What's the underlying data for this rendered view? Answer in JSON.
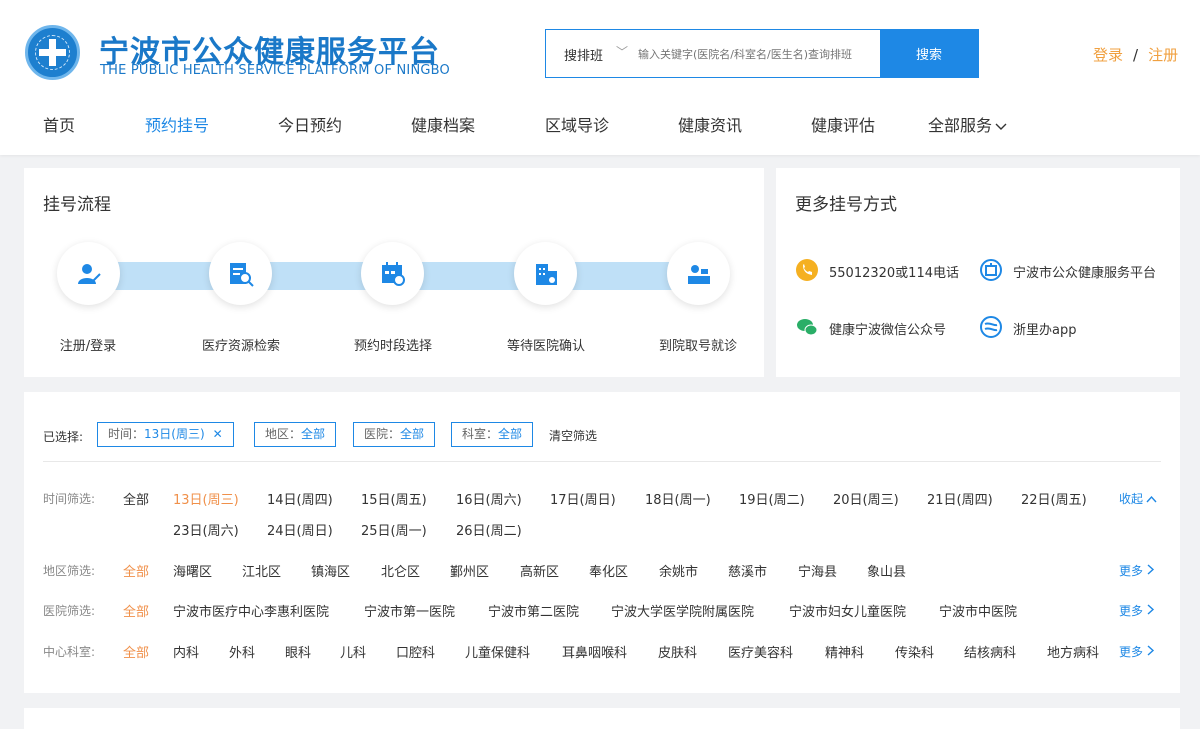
{
  "header": {
    "title": "宁波市公众健康服务平台",
    "subtitle": "THE PUBLIC HEALTH SERVICE PLATFORM OF NINGBO",
    "search_type": "搜排班",
    "search_placeholder": "输入关键字(医院名/科室名/医生名)查询排班",
    "search_button": "搜索",
    "login": "登录",
    "separator": "/",
    "register": "注册"
  },
  "nav": {
    "items": [
      "首页",
      "预约挂号",
      "今日预约",
      "健康档案",
      "区域导诊",
      "健康资讯",
      "健康评估",
      "全部服务"
    ],
    "active_index": 1
  },
  "process": {
    "title": "挂号流程",
    "steps": [
      "注册/登录",
      "医疗资源检索",
      "预约时段选择",
      "等待医院确认",
      "到院取号就诊"
    ]
  },
  "more_ways": {
    "title": "更多挂号方式",
    "items": [
      "55012320或114电话",
      "宁波市公众健康服务平台",
      "健康宁波微信公众号",
      "浙里办app"
    ]
  },
  "selected": {
    "label": "已选择:",
    "chips": [
      {
        "key": "时间：",
        "value": "13日(周三)"
      },
      {
        "key": "地区：",
        "value": "全部"
      },
      {
        "key": "医院：",
        "value": "全部"
      },
      {
        "key": "科室：",
        "value": "全部"
      }
    ],
    "clear": "清空筛选"
  },
  "filters": {
    "time": {
      "label": "时间筛选:",
      "row1": [
        "全部",
        "13日(周三)",
        "14日(周四)",
        "15日(周五)",
        "16日(周六)",
        "17日(周日)",
        "18日(周一)",
        "19日(周二)",
        "20日(周三)",
        "21日(周四)",
        "22日(周五)"
      ],
      "row2": [
        "23日(周六)",
        "24日(周日)",
        "25日(周一)",
        "26日(周二)"
      ],
      "toggle": "收起"
    },
    "area": {
      "label": "地区筛选:",
      "items": [
        "全部",
        "海曙区",
        "江北区",
        "镇海区",
        "北仑区",
        "鄞州区",
        "高新区",
        "奉化区",
        "余姚市",
        "慈溪市",
        "宁海县",
        "象山县"
      ],
      "more": "更多"
    },
    "hospital": {
      "label": "医院筛选:",
      "items": [
        "全部",
        "宁波市医疗中心李惠利医院",
        "宁波市第一医院",
        "宁波市第二医院",
        "宁波大学医学院附属医院",
        "宁波市妇女儿童医院",
        "宁波市中医院"
      ],
      "more": "更多"
    },
    "department": {
      "label": "中心科室:",
      "items": [
        "全部",
        "内科",
        "外科",
        "眼科",
        "儿科",
        "口腔科",
        "儿童保健科",
        "耳鼻咽喉科",
        "皮肤科",
        "医疗美容科",
        "精神科",
        "传染科",
        "结核病科",
        "地方病科"
      ],
      "more": "更多"
    }
  },
  "colors": {
    "primary": "#1e88e5",
    "accent": "#f0904a",
    "auth": "#f0a040"
  }
}
